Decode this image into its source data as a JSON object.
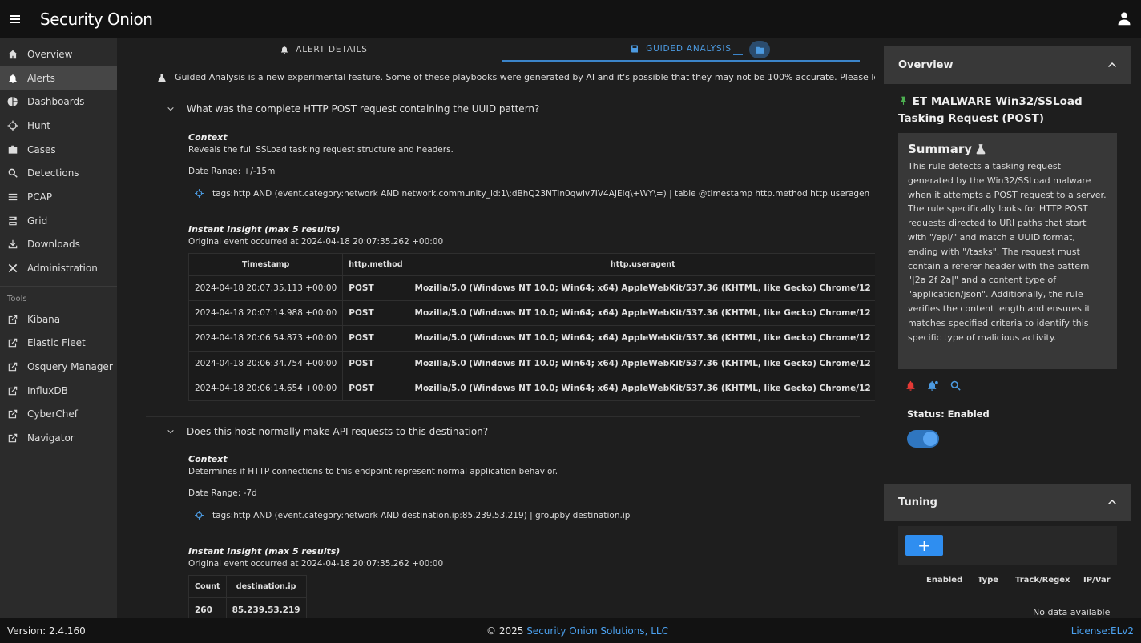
{
  "app": {
    "brand": "Security Onion",
    "version": "Version: 2.4.160",
    "copyright_prefix": "© 2025",
    "copyright_link": "Security Onion Solutions, LLC",
    "license": "License:ELv2"
  },
  "sidebar": {
    "items": [
      {
        "label": "Overview",
        "icon": "home-icon"
      },
      {
        "label": "Alerts",
        "icon": "bell-icon"
      },
      {
        "label": "Dashboards",
        "icon": "pie-icon"
      },
      {
        "label": "Hunt",
        "icon": "crosshair-icon"
      },
      {
        "label": "Cases",
        "icon": "briefcase-icon"
      },
      {
        "label": "Detections",
        "icon": "search-icon"
      },
      {
        "label": "PCAP",
        "icon": "lines-icon"
      },
      {
        "label": "Grid",
        "icon": "grid-icon"
      },
      {
        "label": "Downloads",
        "icon": "download-icon"
      },
      {
        "label": "Administration",
        "icon": "tools-icon"
      }
    ],
    "tools_header": "Tools",
    "tools": [
      {
        "label": "Kibana"
      },
      {
        "label": "Elastic Fleet"
      },
      {
        "label": "Osquery Manager"
      },
      {
        "label": "InfluxDB"
      },
      {
        "label": "CyberChef"
      },
      {
        "label": "Navigator"
      }
    ]
  },
  "main": {
    "tabs": [
      {
        "label": "ALERT DETAILS"
      },
      {
        "label": "GUIDED ANALYSIS"
      }
    ],
    "banner": "Guided Analysis is a new experimental feature. Some of these playbooks were generated by AI and it's possible that they may not be 100% accurate. Please let us",
    "questions": [
      {
        "question": "What was the complete HTTP POST request containing the UUID pattern?",
        "context_label": "Context",
        "context": "Reveals the full SSLoad tasking request structure and headers.",
        "date_range": "Date Range: +/-15m",
        "query": "tags:http AND (event.category:network AND network.community_id:1\\:dBhQ23NTIn0qwiv7IV4AJElq\\+WY\\=) | table @timestamp http.method http.useragen",
        "insight_label": "Instant Insight (max 5 results)",
        "original_event": "Original event occurred at 2024-04-18 20:07:35.262 +00:00",
        "columns": [
          "Timestamp",
          "http.method",
          "http.useragent"
        ],
        "rows": [
          [
            "2024-04-18 20:07:35.113 +00:00",
            "POST",
            "Mozilla/5.0 (Windows NT 10.0; Win64; x64) AppleWebKit/537.36 (KHTML, like Gecko) Chrome/12"
          ],
          [
            "2024-04-18 20:07:14.988 +00:00",
            "POST",
            "Mozilla/5.0 (Windows NT 10.0; Win64; x64) AppleWebKit/537.36 (KHTML, like Gecko) Chrome/12"
          ],
          [
            "2024-04-18 20:06:54.873 +00:00",
            "POST",
            "Mozilla/5.0 (Windows NT 10.0; Win64; x64) AppleWebKit/537.36 (KHTML, like Gecko) Chrome/12"
          ],
          [
            "2024-04-18 20:06:34.754 +00:00",
            "POST",
            "Mozilla/5.0 (Windows NT 10.0; Win64; x64) AppleWebKit/537.36 (KHTML, like Gecko) Chrome/12"
          ],
          [
            "2024-04-18 20:06:14.654 +00:00",
            "POST",
            "Mozilla/5.0 (Windows NT 10.0; Win64; x64) AppleWebKit/537.36 (KHTML, like Gecko) Chrome/12"
          ]
        ]
      },
      {
        "question": "Does this host normally make API requests to this destination?",
        "context_label": "Context",
        "context": "Determines if HTTP connections to this endpoint represent normal application behavior.",
        "date_range": "Date Range: -7d",
        "query": "tags:http AND (event.category:network AND destination.ip:85.239.53.219) | groupby destination.ip",
        "insight_label": "Instant Insight (max 5 results)",
        "original_event": "Original event occurred at 2024-04-18 20:07:35.262 +00:00",
        "columns": [
          "Count",
          "destination.ip"
        ],
        "rows": [
          [
            "260",
            "85.239.53.219"
          ]
        ]
      }
    ]
  },
  "overview": {
    "header": "Overview",
    "rule_title": "ET MALWARE Win32/SSLoad Tasking Request (POST)",
    "summary_title": "Summary",
    "summary_text": "This rule detects a tasking request generated by the Win32/SSLoad malware when it attempts a POST request to a server. The rule specifically looks for HTTP POST requests directed to URI paths that start with \"/api/\" and match a UUID format, ending with \"/tasks\". The request must contain a referer header with the pattern \"|2a 2f 2a|\" and a content type of \"application/json\". Additionally, the rule verifies the content length and ensures it matches specified criteria to identify this specific type of malicious activity.",
    "status": "Status: Enabled",
    "enabled": true
  },
  "tuning": {
    "header": "Tuning",
    "add_label": "+",
    "columns": [
      "Enabled",
      "Type",
      "Track/Regex",
      "IP/Var"
    ],
    "empty": "No data available"
  },
  "colors": {
    "accent": "#4ca2f0",
    "alert_red": "#e53935",
    "pin_green": "#4caf50"
  }
}
